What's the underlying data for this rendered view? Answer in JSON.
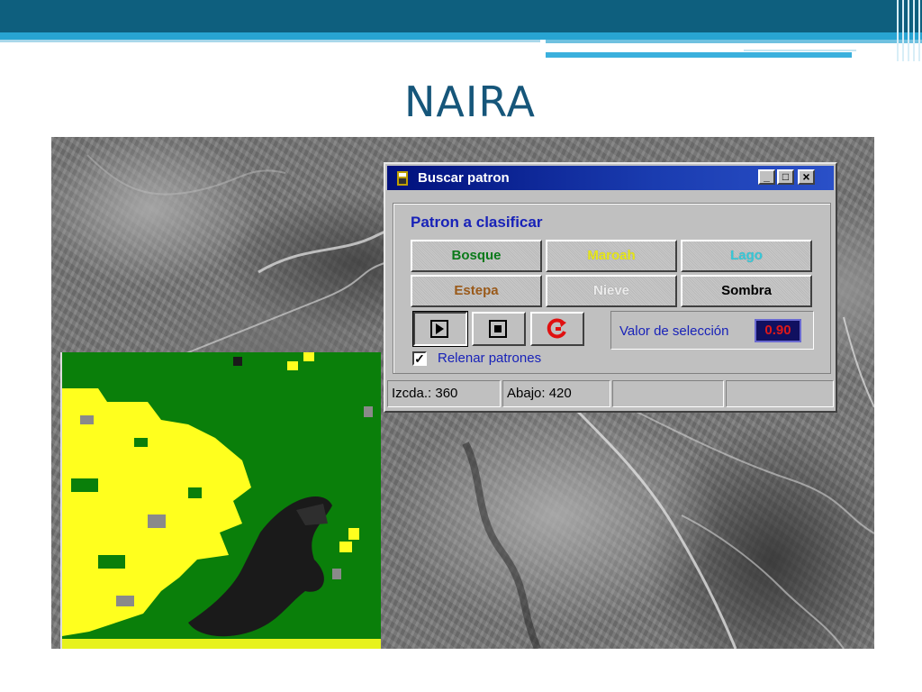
{
  "slide": {
    "title": "NAIRA"
  },
  "dialog": {
    "title": "Buscar patron",
    "window_buttons": {
      "minimize": "_",
      "maximize": "□",
      "close": "×"
    },
    "group_title": "Patron a clasificar",
    "patterns": [
      {
        "label": "Bosque",
        "color": "#0a7a1a"
      },
      {
        "label": "Maroah",
        "color": "#e8e81a"
      },
      {
        "label": "Lago",
        "color": "#36c8d8"
      },
      {
        "label": "Estepa",
        "color": "#9a5a1a"
      },
      {
        "label": "Nieve",
        "color": "#ececec"
      },
      {
        "label": "Sombra",
        "color": "#000000"
      }
    ],
    "controls": [
      {
        "icon": "play-icon"
      },
      {
        "icon": "stop-icon"
      },
      {
        "icon": "reset-icon"
      }
    ],
    "selection_label": "Valor de selección",
    "selection_value": "0.90",
    "fill_patterns": {
      "checked": true,
      "label": "Relenar patrones"
    },
    "status": {
      "left": "Izcda.: 360",
      "down": "Abajo: 420",
      "panel3": "",
      "panel4": ""
    }
  },
  "colors": {
    "header_dark": "#0e5f7e",
    "header_light": "#28a4d2",
    "title_text": "#16567a",
    "class_forest": "#0a7f0a",
    "class_shrub": "#ffff1e",
    "class_shadow": "#1a1a1a"
  }
}
